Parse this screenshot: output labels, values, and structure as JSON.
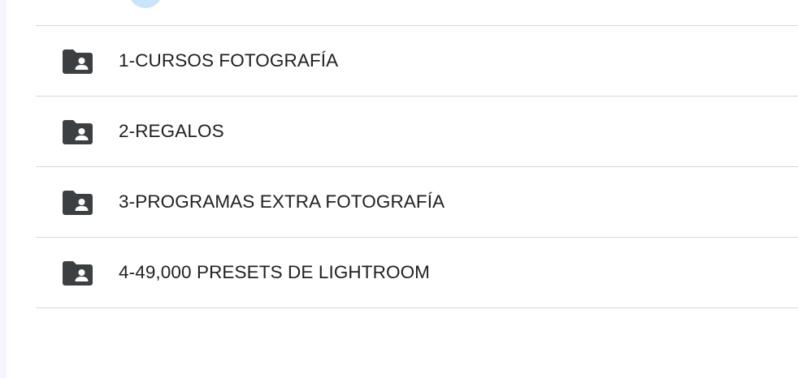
{
  "folders": [
    {
      "icon": "shared-folder-icon",
      "name": "1-CURSOS FOTOGRAFÍA"
    },
    {
      "icon": "shared-folder-icon",
      "name": "2-REGALOS"
    },
    {
      "icon": "shared-folder-icon",
      "name": "3-PROGRAMAS EXTRA FOTOGRAFÍA"
    },
    {
      "icon": "shared-folder-icon",
      "name": "4-49,000 PRESETS DE LIGHTROOM"
    }
  ],
  "colors": {
    "text": "#202124",
    "icon": "#3c4043",
    "divider": "#d7d7d7",
    "avatar": "#c9e4fb"
  }
}
